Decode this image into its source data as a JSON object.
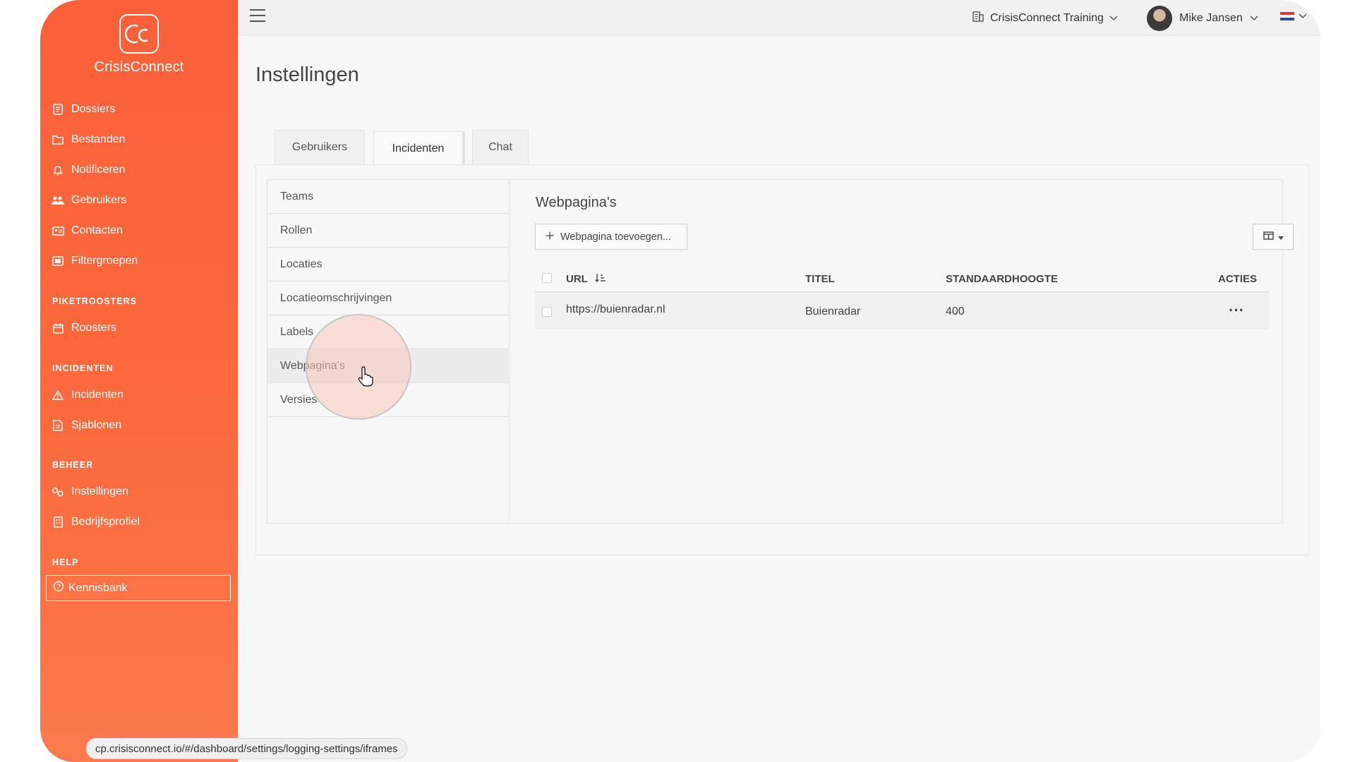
{
  "app": {
    "name": "CrisisConnect",
    "logo_letters": "CC"
  },
  "colors": {
    "sidebar_accent": "#f9603a",
    "highlight": "#f7c6bc"
  },
  "sidebar": {
    "items_top": [
      {
        "label": "Dossiers",
        "icon": "document-icon"
      },
      {
        "label": "Bestanden",
        "icon": "folder-icon"
      },
      {
        "label": "Notificeren",
        "icon": "bell-icon"
      },
      {
        "label": "Gebruikers",
        "icon": "users-icon"
      },
      {
        "label": "Contacten",
        "icon": "contact-card-icon"
      },
      {
        "label": "Filtergroepen",
        "icon": "filter-group-icon"
      }
    ],
    "section_piket": "PIKETROOSTERS",
    "item_roosters": "Roosters",
    "section_incidenten": "INCIDENTEN",
    "item_incidenten": "Incidenten",
    "item_sjablonen": "Sjablonen",
    "section_beheer": "BEHEER",
    "item_instellingen": "Instellingen",
    "item_bedrijfsprofiel": "Bedrijfsprofiel",
    "section_help": "HELP",
    "item_kennisbank": "Kennisbank"
  },
  "topbar": {
    "org_name": "CrisisConnect Training",
    "user_name": "Mike Jansen",
    "language_flag": "nl-flag-icon"
  },
  "page": {
    "title": "Instellingen",
    "tabs": [
      "Gebruikers",
      "Incidenten",
      "Chat"
    ],
    "active_tab": "Incidenten"
  },
  "left_menu": {
    "items": [
      "Teams",
      "Rollen",
      "Locaties",
      "Locatieomschrijvingen",
      "Labels",
      "Webpagina's",
      "Versies"
    ],
    "active": "Webpagina's"
  },
  "webpages": {
    "title": "Webpagina's",
    "add_button": "Webpagina toevoegen...",
    "columns": {
      "url": "URL",
      "title": "TITEL",
      "height": "STANDAARDHOOGTE",
      "actions": "ACTIES"
    },
    "rows": [
      {
        "url": "https://buienradar.nl",
        "title": "Buienradar",
        "height": "400",
        "actions": "···"
      }
    ]
  },
  "statusbar": {
    "url": "cp.crisisconnect.io/#/dashboard/settings/logging-settings/iframes"
  }
}
